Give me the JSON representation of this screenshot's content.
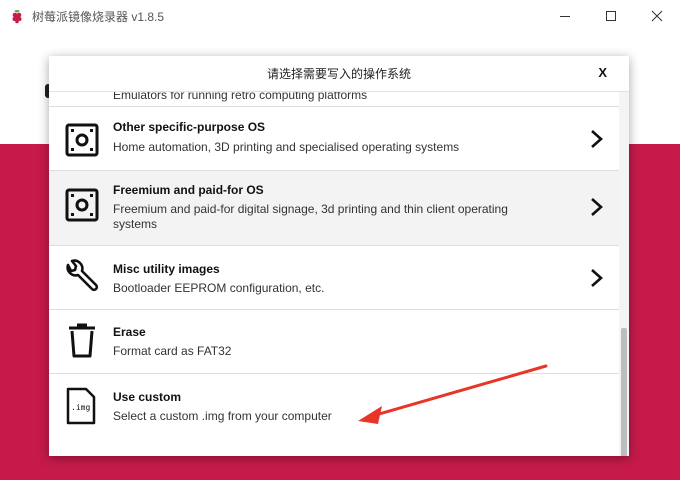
{
  "window": {
    "title": "树莓派镜像烧录器 v1.8.5",
    "controls": {
      "minimize_icon": "minimize-icon",
      "maximize_icon": "maximize-icon",
      "close_icon": "close-icon"
    }
  },
  "colors": {
    "brand_background": "#c51a4a",
    "annotation_arrow": "#e8352a"
  },
  "dialog": {
    "title": "请选择需要写入的操作系统",
    "close_label": "X",
    "partial_item_desc": "Emulators for running retro computing platforms",
    "items": [
      {
        "title": "Other specific-purpose OS",
        "description": "Home automation, 3D printing and specialised operating systems",
        "icon": "sd-card-icon",
        "has_submenu": true
      },
      {
        "title": "Freemium and paid-for OS",
        "description": "Freemium and paid-for digital signage, 3d printing and thin client operating systems",
        "icon": "sd-card-icon",
        "has_submenu": true
      },
      {
        "title": "Misc utility images",
        "description": "Bootloader EEPROM configuration, etc.",
        "icon": "wrench-icon",
        "has_submenu": true
      },
      {
        "title": "Erase",
        "description": "Format card as FAT32",
        "icon": "trash-icon",
        "has_submenu": false
      },
      {
        "title": "Use custom",
        "description": "Select a custom .img from your computer",
        "icon": "img-file-icon",
        "icon_label": ".img",
        "has_submenu": false
      }
    ]
  }
}
